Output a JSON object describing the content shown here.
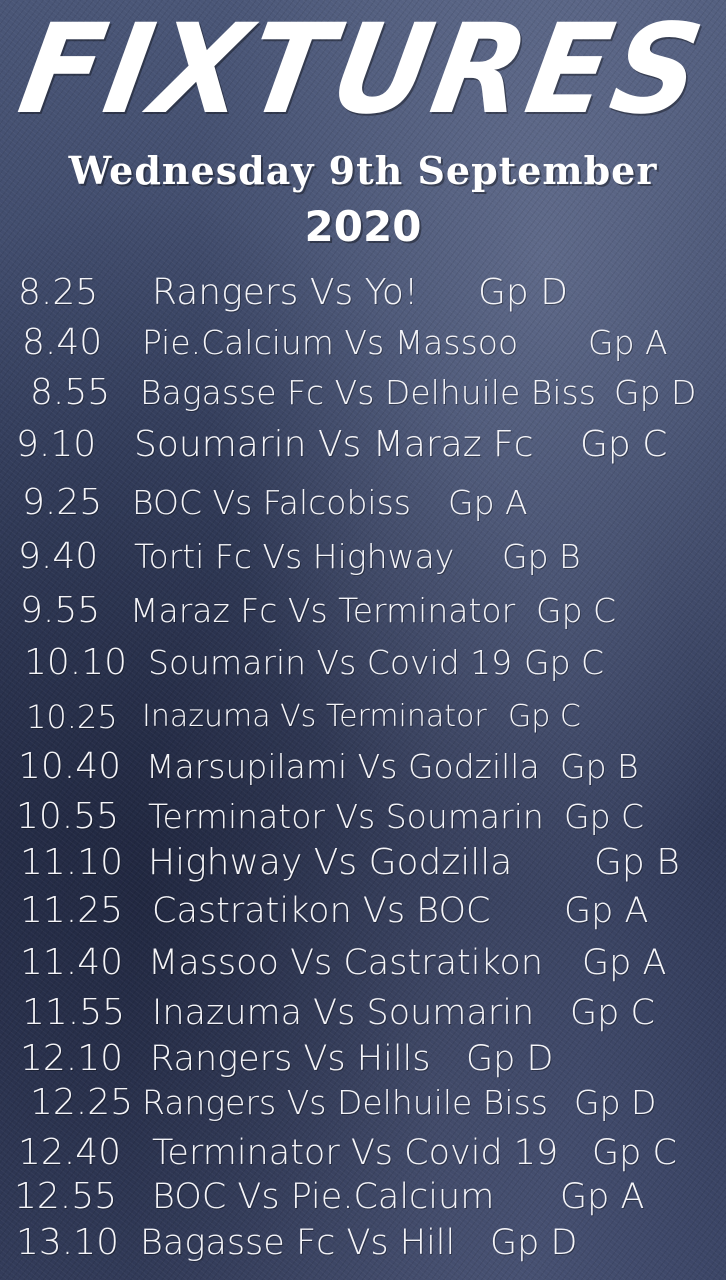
{
  "header": {
    "title": "FIXTURES",
    "date": "Wednesday 9th September",
    "year": "2020"
  },
  "fixtures": [
    {
      "time": "8.25",
      "match": "Rangers Vs Yo!",
      "group": "Gp D"
    },
    {
      "time": "8.40",
      "match": "Pie.Calcium Vs Massoo",
      "group": "Gp A"
    },
    {
      "time": "8.55",
      "match": "Bagasse Fc Vs Delhuile Biss",
      "group": "Gp D"
    },
    {
      "time": "9.10",
      "match": "Soumarin Vs Maraz Fc",
      "group": "Gp C"
    },
    {
      "time": "9.25",
      "match": "BOC Vs Falcobiss",
      "group": "Gp A"
    },
    {
      "time": "9.40",
      "match": "Torti Fc Vs Highway",
      "group": "Gp B"
    },
    {
      "time": "9.55",
      "match": "Maraz Fc Vs Terminator",
      "group": "Gp C"
    },
    {
      "time": "10.10",
      "match": "Soumarin Vs Covid 19",
      "group": "Gp C"
    },
    {
      "time": "10.25",
      "match": "Inazuma Vs Terminator",
      "group": "Gp C"
    },
    {
      "time": "10.40",
      "match": "Marsupilami Vs Godzilla",
      "group": "Gp B"
    },
    {
      "time": "10.55",
      "match": "Terminator Vs Soumarin",
      "group": "Gp C"
    },
    {
      "time": "11.10",
      "match": "Highway Vs Godzilla",
      "group": "Gp B"
    },
    {
      "time": "11.25",
      "match": "Castratikon Vs BOC",
      "group": "Gp A"
    },
    {
      "time": "11.40",
      "match": "Massoo Vs Castratikon",
      "group": "Gp A"
    },
    {
      "time": "11.55",
      "match": "Inazuma Vs Soumarin",
      "group": "Gp C"
    },
    {
      "time": "12.10",
      "match": "Rangers Vs Hills",
      "group": "Gp D"
    },
    {
      "time": "12.25",
      "match": "Rangers Vs Delhuile Biss",
      "group": "Gp D"
    },
    {
      "time": "12.40",
      "match": "Terminator Vs Covid 19",
      "group": "Gp C"
    },
    {
      "time": "12.55",
      "match": "BOC Vs Pie.Calcium",
      "group": "Gp A"
    },
    {
      "time": "13.10",
      "match": "Bagasse Fc Vs Hill",
      "group": "Gp D"
    }
  ]
}
